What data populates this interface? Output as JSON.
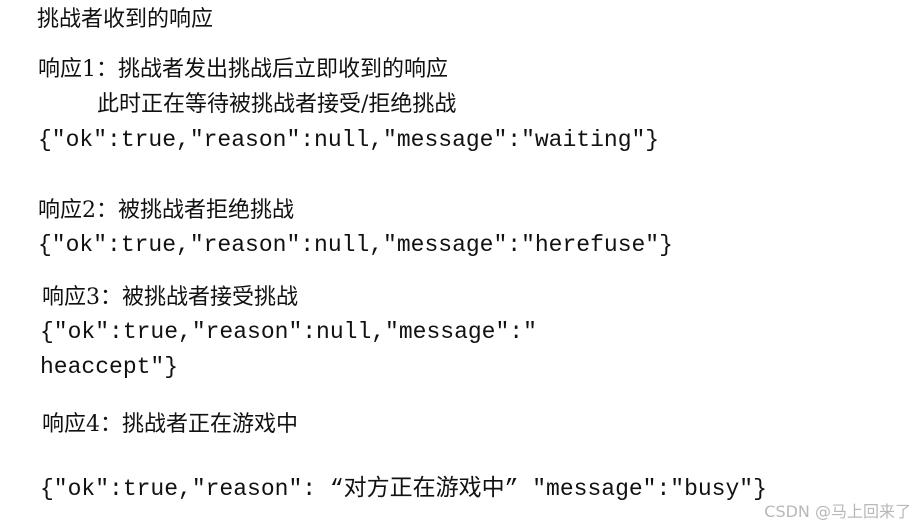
{
  "title": "挑战者收到的响应",
  "responses": [
    {
      "heading": "响应1：挑战者发出挑战后立即收到的响应",
      "subheading": "此时正在等待被挑战者接受/拒绝挑战",
      "json": "{″ok″:true,″reason″:null,″message″:″waiting″}"
    },
    {
      "heading": "响应2：被挑战者拒绝挑战",
      "json": "{″ok″:true,″reason″:null,″message″:″herefuse″}"
    },
    {
      "heading": "响应3：被挑战者接受挑战",
      "json": "{″ok″:true,″reason″:null,″message″:″",
      "json_cont": "heaccept″}"
    },
    {
      "heading": "响应4：挑战者正在游戏中",
      "json": "{″ok″:true,″reason″: “对方正在游戏中” ″message″:″busy″}"
    }
  ],
  "watermark": "CSDN @马上回来了"
}
